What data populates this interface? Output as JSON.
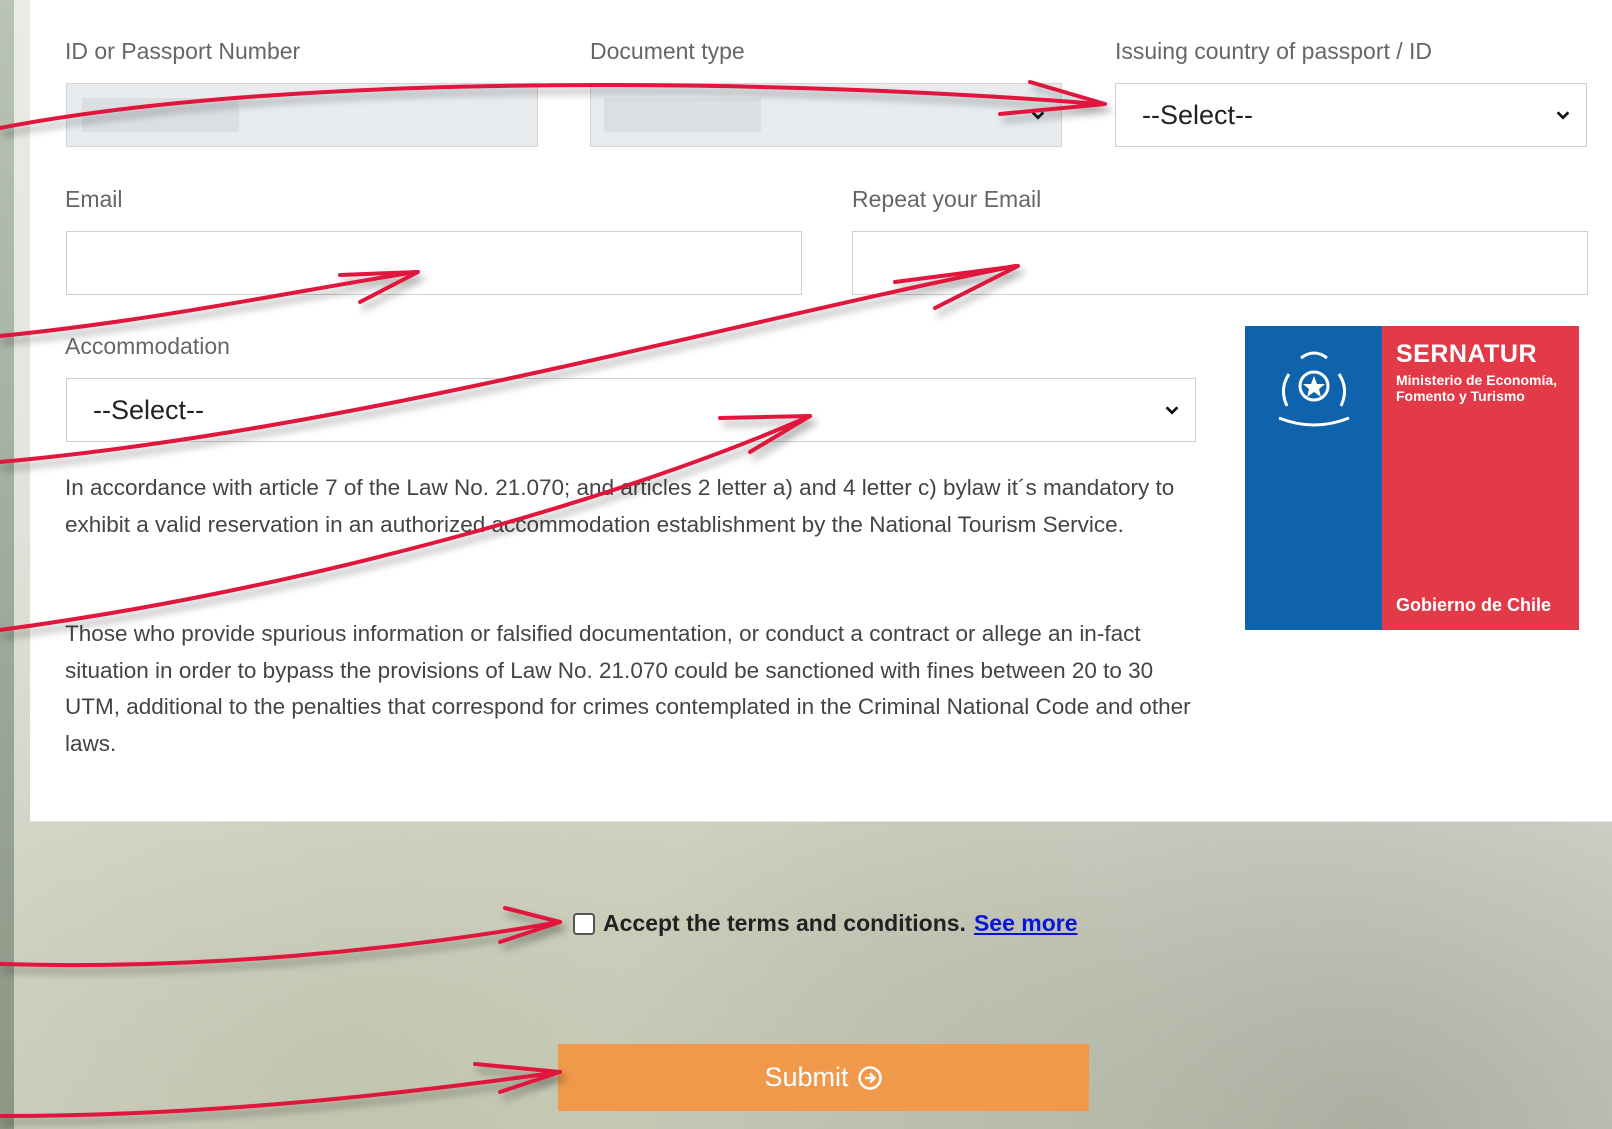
{
  "form": {
    "id_label": "ID or Passport Number",
    "doc_type_label": "Document type",
    "country_label": "Issuing country of passport / ID",
    "country_value": "--Select--",
    "email_label": "Email",
    "email_value": "",
    "repeat_email_label": "Repeat your Email",
    "repeat_email_value": "",
    "accommodation_label": "Accommodation",
    "accommodation_value": "--Select--"
  },
  "legal": {
    "paragraph1": "In accordance with article 7 of the Law No. 21.070; and articles 2 letter a) and 4 letter c) bylaw it´s mandatory to exhibit a valid reservation in an authorized accommodation establishment by the National Tourism Service.",
    "paragraph2": "Those who provide spurious information or falsified documentation, or conduct a contract or allege an in-fact situation in order to bypass the provisions of Law No. 21.070 could be sanctioned with fines between 20 to 30 UTM, additional to the penalties that correspond for crimes contemplated in the Criminal National Code and other laws."
  },
  "logo": {
    "title": "SERNATUR",
    "subtitle": "Ministerio de Economía, Fomento y Turismo",
    "footer": "Gobierno de Chile"
  },
  "terms": {
    "text": "Accept the terms and conditions.",
    "link": "See more",
    "checked": false
  },
  "submit": {
    "label": "Submit"
  },
  "colors": {
    "accent_orange": "#f0994a",
    "arrow_red": "#e0143c",
    "logo_blue": "#0f63ad",
    "logo_red": "#e23a48",
    "link_blue": "#0a14d6"
  }
}
